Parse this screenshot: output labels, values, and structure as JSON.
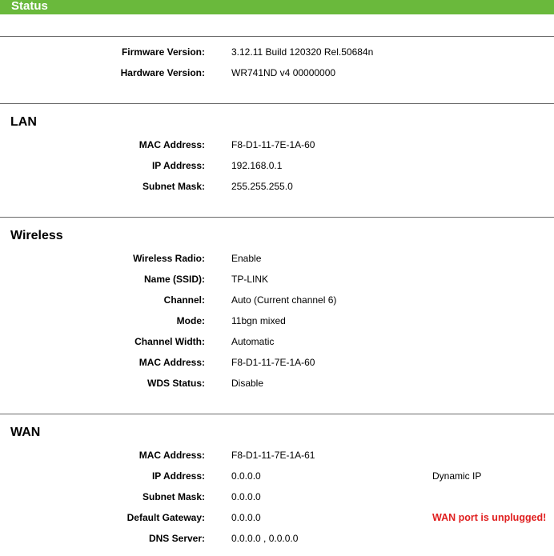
{
  "header": {
    "title": "Status",
    "accent_color": "#6ab93c"
  },
  "sections": {
    "general": {
      "rows": [
        {
          "label": "Firmware Version:",
          "value": "3.12.11 Build 120320 Rel.50684n"
        },
        {
          "label": "Hardware Version:",
          "value": "WR741ND v4 00000000"
        }
      ]
    },
    "lan": {
      "title": "LAN",
      "rows": [
        {
          "label": "MAC Address:",
          "value": "F8-D1-11-7E-1A-60"
        },
        {
          "label": "IP Address:",
          "value": "192.168.0.1"
        },
        {
          "label": "Subnet Mask:",
          "value": "255.255.255.0"
        }
      ]
    },
    "wireless": {
      "title": "Wireless",
      "rows": [
        {
          "label": "Wireless Radio:",
          "value": "Enable"
        },
        {
          "label": "Name (SSID):",
          "value": "TP-LINK"
        },
        {
          "label": "Channel:",
          "value": "Auto (Current channel 6)"
        },
        {
          "label": "Mode:",
          "value": "11bgn mixed"
        },
        {
          "label": "Channel Width:",
          "value": "Automatic"
        },
        {
          "label": "MAC Address:",
          "value": "F8-D1-11-7E-1A-60"
        },
        {
          "label": "WDS Status:",
          "value": "Disable"
        }
      ]
    },
    "wan": {
      "title": "WAN",
      "connection_type": "Dynamic IP",
      "alert": "WAN port is unplugged!",
      "alert_color": "#e02020",
      "rows": [
        {
          "label": "MAC Address:",
          "value": "F8-D1-11-7E-1A-61"
        },
        {
          "label": "IP Address:",
          "value": "0.0.0.0"
        },
        {
          "label": "Subnet Mask:",
          "value": "0.0.0.0"
        },
        {
          "label": "Default Gateway:",
          "value": "0.0.0.0"
        },
        {
          "label": "DNS Server:",
          "value": "0.0.0.0 , 0.0.0.0"
        }
      ]
    }
  }
}
